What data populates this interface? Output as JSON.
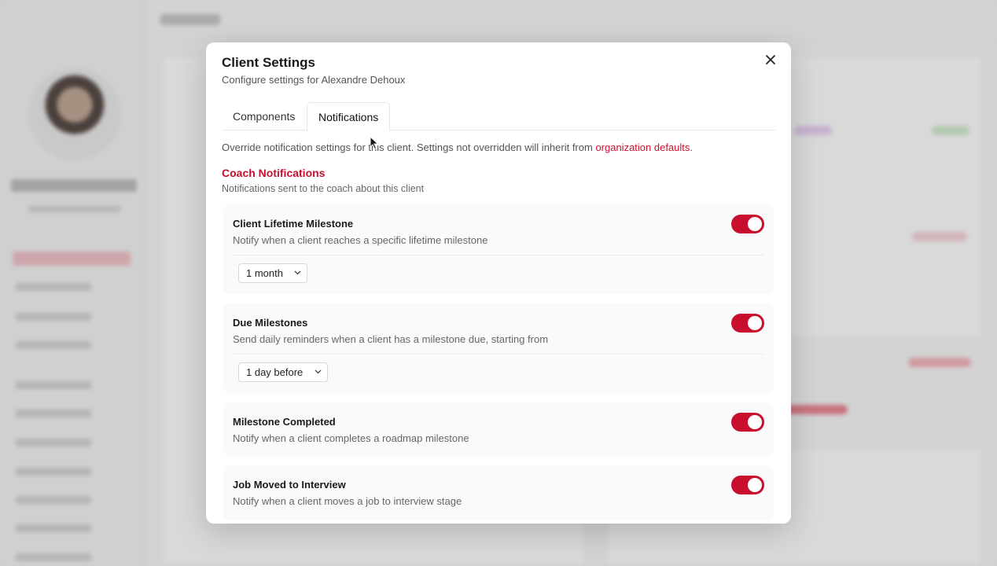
{
  "modal": {
    "title": "Client Settings",
    "subtitle": "Configure settings for Alexandre Dehoux",
    "close_icon": "close-icon"
  },
  "tabs": [
    {
      "label": "Components",
      "active": false
    },
    {
      "label": "Notifications",
      "active": true
    }
  ],
  "intro": {
    "text": "Override notification settings for this client. Settings not overridden will inherit from ",
    "link": "organization defaults",
    "suffix": "."
  },
  "section": {
    "title": "Coach Notifications",
    "subtitle": "Notifications sent to the coach about this client"
  },
  "settings": [
    {
      "title": "Client Lifetime Milestone",
      "description": "Notify when a client reaches a specific lifetime milestone",
      "enabled": true,
      "select": "1 month"
    },
    {
      "title": "Due Milestones",
      "description": "Send daily reminders when a client has a milestone due, starting from",
      "enabled": true,
      "select": "1 day before"
    },
    {
      "title": "Milestone Completed",
      "description": "Notify when a client completes a roadmap milestone",
      "enabled": true
    },
    {
      "title": "Job Moved to Interview",
      "description": "Notify when a client moves a job to interview stage",
      "enabled": true
    }
  ],
  "colors": {
    "accent": "#c8102e"
  }
}
